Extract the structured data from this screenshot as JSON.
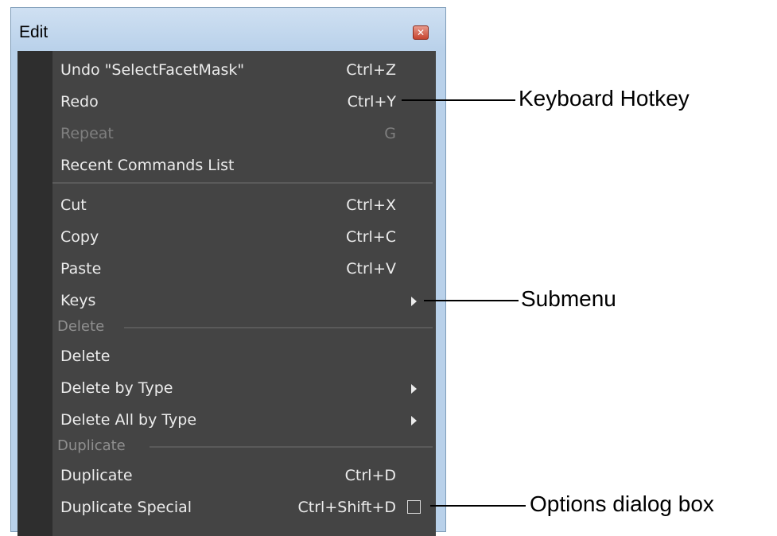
{
  "window": {
    "title": "Edit",
    "close_glyph": "✕"
  },
  "menu": {
    "items": [
      {
        "label": "Undo \"SelectFacetMask\"",
        "hotkey": "Ctrl+Z"
      },
      {
        "label": "Redo",
        "hotkey": "Ctrl+Y"
      },
      {
        "label": "Repeat",
        "hotkey": "G",
        "disabled": true
      },
      {
        "label": "Recent Commands List",
        "hotkey": ""
      },
      {
        "label": "Cut",
        "hotkey": "Ctrl+X"
      },
      {
        "label": "Copy",
        "hotkey": "Ctrl+C"
      },
      {
        "label": "Paste",
        "hotkey": "Ctrl+V"
      },
      {
        "label": "Keys",
        "hotkey": "",
        "submenu": true
      },
      {
        "label": "Delete",
        "hotkey": ""
      },
      {
        "label": "Delete by Type",
        "hotkey": "",
        "submenu": true
      },
      {
        "label": "Delete All by Type",
        "hotkey": "",
        "submenu": true
      },
      {
        "label": "Duplicate",
        "hotkey": "Ctrl+D"
      },
      {
        "label": "Duplicate Special",
        "hotkey": "Ctrl+Shift+D",
        "options_box": true
      }
    ],
    "sections": {
      "delete": "Delete",
      "duplicate": "Duplicate"
    }
  },
  "annotations": {
    "keyboard_hotkey": "Keyboard Hotkey",
    "submenu": "Submenu",
    "options_dialog_box": "Options dialog box"
  },
  "colors": {
    "menu_background": "#444444",
    "gutter": "#2e2e2e",
    "text": "#ececec",
    "disabled_text": "#7f7f7f",
    "window_frame": "#b9d1ea"
  }
}
